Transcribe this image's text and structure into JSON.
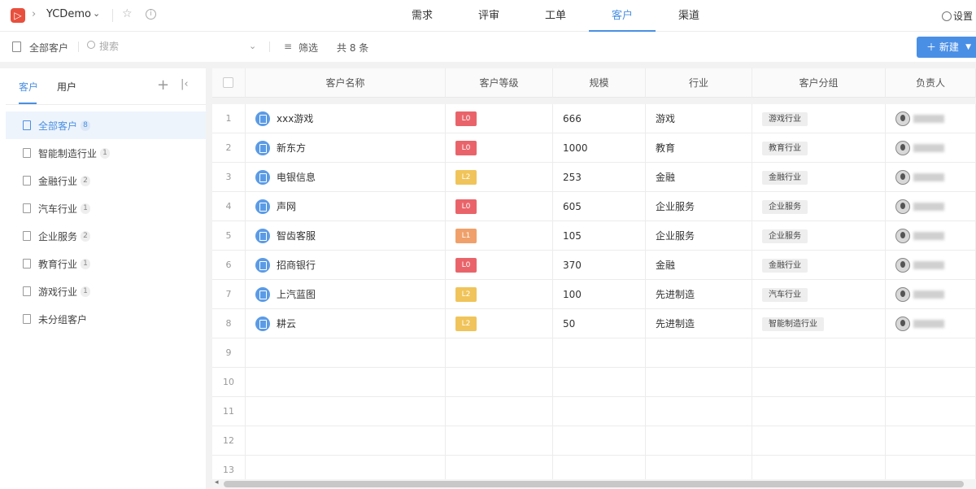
{
  "app": {
    "logo_glyph": "▷",
    "project_name": "YCDemo"
  },
  "nav_tabs": [
    {
      "label": "需求",
      "active": false
    },
    {
      "label": "评审",
      "active": false
    },
    {
      "label": "工单",
      "active": false
    },
    {
      "label": "客户",
      "active": true
    },
    {
      "label": "渠道",
      "active": false
    }
  ],
  "settings_label": "设置",
  "toolbar": {
    "view_label": "全部客户",
    "search_placeholder": "搜索",
    "filter_label": "筛选",
    "count_text": "共 8 条",
    "new_label": "新建"
  },
  "sidebar": {
    "tabs": [
      "客户",
      "用户"
    ],
    "items": [
      {
        "label": "全部客户",
        "count": "8",
        "active": true
      },
      {
        "label": "智能制造行业",
        "count": "1",
        "active": false
      },
      {
        "label": "金融行业",
        "count": "2",
        "active": false
      },
      {
        "label": "汽车行业",
        "count": "1",
        "active": false
      },
      {
        "label": "企业服务",
        "count": "2",
        "active": false
      },
      {
        "label": "教育行业",
        "count": "1",
        "active": false
      },
      {
        "label": "游戏行业",
        "count": "1",
        "active": false
      },
      {
        "label": "未分组客户",
        "count": "",
        "active": false
      }
    ]
  },
  "table": {
    "columns": [
      "客户名称",
      "客户等级",
      "规模",
      "行业",
      "客户分组",
      "负责人"
    ],
    "rows": [
      {
        "num": "1",
        "name": "xxx游戏",
        "level": "L0",
        "scale": "666",
        "industry": "游戏",
        "group": "游戏行业"
      },
      {
        "num": "2",
        "name": "新东方",
        "level": "L0",
        "scale": "1000",
        "industry": "教育",
        "group": "教育行业"
      },
      {
        "num": "3",
        "name": "电银信息",
        "level": "L2",
        "scale": "253",
        "industry": "金融",
        "group": "金融行业"
      },
      {
        "num": "4",
        "name": "声网",
        "level": "L0",
        "scale": "605",
        "industry": "企业服务",
        "group": "企业服务"
      },
      {
        "num": "5",
        "name": "智齿客服",
        "level": "L1",
        "scale": "105",
        "industry": "企业服务",
        "group": "企业服务"
      },
      {
        "num": "6",
        "name": "招商银行",
        "level": "L0",
        "scale": "370",
        "industry": "金融",
        "group": "金融行业"
      },
      {
        "num": "7",
        "name": "上汽蓝图",
        "level": "L2",
        "scale": "100",
        "industry": "先进制造",
        "group": "汽车行业"
      },
      {
        "num": "8",
        "name": "耕云",
        "level": "L2",
        "scale": "50",
        "industry": "先进制造",
        "group": "智能制造行业"
      }
    ],
    "empty_row_numbers": [
      "9",
      "10",
      "11",
      "12",
      "13"
    ]
  },
  "level_colors": {
    "L0": "#e9646a",
    "L1": "#f0a06a",
    "L2": "#f0c45a"
  }
}
